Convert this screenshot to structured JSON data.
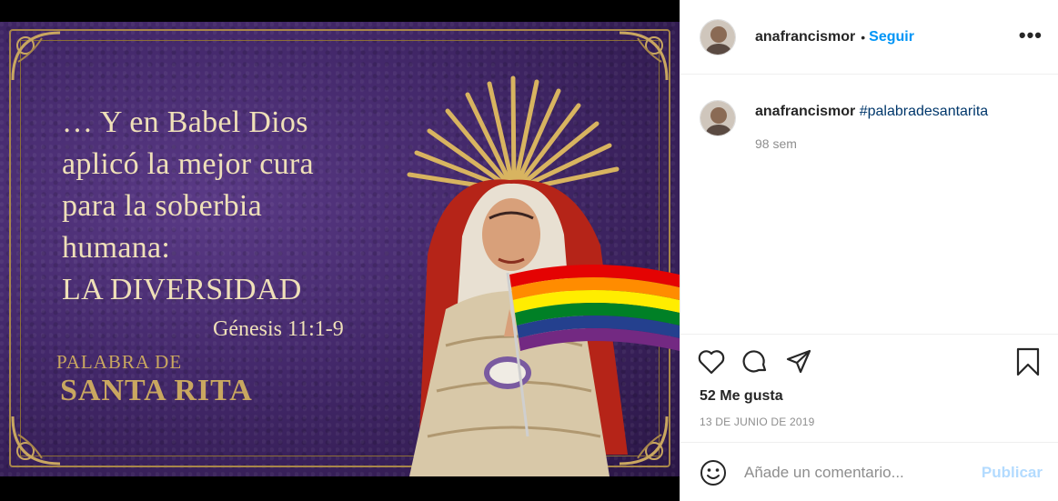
{
  "post": {
    "image": {
      "quote_lines": [
        "… Y en Babel Dios",
        "aplicó la mejor cura",
        "para la soberbia",
        "humana:",
        "LA DIVERSIDAD"
      ],
      "reference": "Génesis 11:1-9",
      "brand_line1": "PALABRA DE",
      "brand_line2": "SANTA RITA"
    }
  },
  "header": {
    "username": "anafrancismor",
    "dot": "•",
    "follow_label": "Seguir",
    "more_label": "•••"
  },
  "caption": {
    "username": "anafrancismor",
    "hashtag": "#palabradesantarita",
    "time": "98 sem"
  },
  "actions": {
    "icons": [
      "heart-icon",
      "comment-icon",
      "share-icon",
      "bookmark-icon"
    ]
  },
  "likes": "52 Me gusta",
  "date": "13 DE JUNIO DE 2019",
  "add_comment": {
    "placeholder": "Añade un comentario...",
    "publish_label": "Publicar"
  },
  "colors": {
    "accent": "#0095f6",
    "publish_disabled": "#b3dbff",
    "hashtag": "#00376b",
    "gold": "#c9a760"
  }
}
